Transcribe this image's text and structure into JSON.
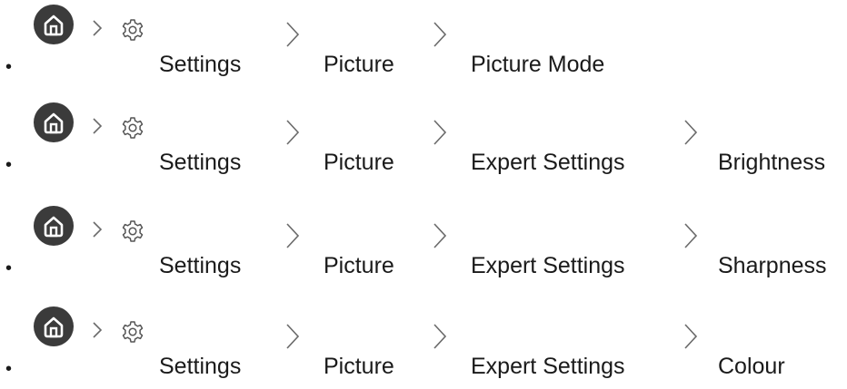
{
  "paths": [
    {
      "bullet": "•",
      "items": [
        "Settings",
        "Picture",
        "Picture Mode"
      ]
    },
    {
      "bullet": "•",
      "items": [
        "Settings",
        "Picture",
        "Expert Settings",
        "Brightness"
      ]
    },
    {
      "bullet": "•",
      "items": [
        "Settings",
        "Picture",
        "Expert Settings",
        "Sharpness"
      ]
    },
    {
      "bullet": "•",
      "items": [
        "Settings",
        "Picture",
        "Expert Settings",
        "Colour"
      ]
    }
  ],
  "icons": {
    "home": "home-icon",
    "settings": "gear-icon",
    "separator": "chevron-right-icon"
  },
  "colors": {
    "home_button_bg": "#3b3b3b",
    "icon_stroke": "#555555",
    "text": "#1a1a1a",
    "chevron": "#6a6a6a"
  }
}
